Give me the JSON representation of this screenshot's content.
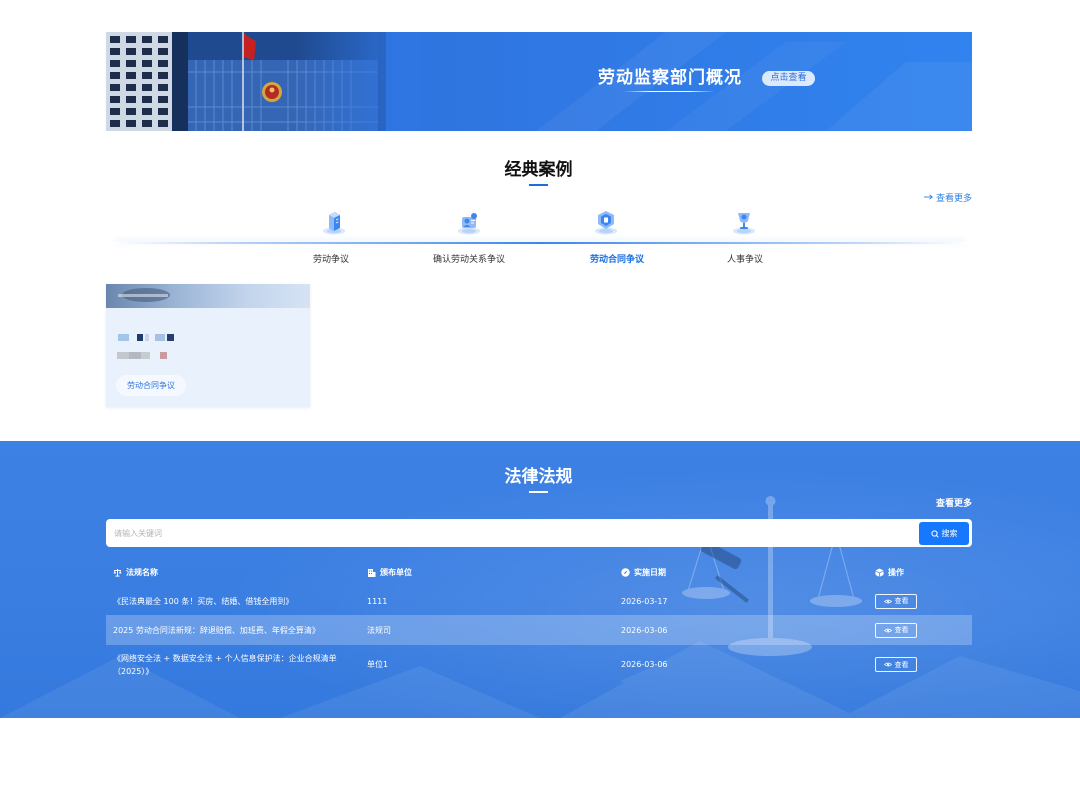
{
  "banner": {
    "title": "劳动监察部门概况",
    "button": "点击查看"
  },
  "cases": {
    "title": "经典案例",
    "more": "查看更多",
    "more_icon": "arrow-right-icon",
    "categories": [
      {
        "label": "劳动争议",
        "icon": "document-stack-icon",
        "active": false
      },
      {
        "label": "确认劳动关系争议",
        "icon": "person-badge-icon",
        "active": false
      },
      {
        "label": "劳动合同争议",
        "icon": "shield-document-icon",
        "active": true
      },
      {
        "label": "人事争议",
        "icon": "person-trophy-icon",
        "active": false
      }
    ],
    "cards": [
      {
        "tag": "劳动合同争议"
      }
    ]
  },
  "laws": {
    "title": "法律法规",
    "more": "查看更多",
    "search": {
      "placeholder": "请输入关键词",
      "button": "搜索",
      "icon": "search-icon"
    },
    "columns": [
      {
        "label": "法规名称",
        "icon": "scales-icon"
      },
      {
        "label": "颁布单位",
        "icon": "building-icon"
      },
      {
        "label": "实施日期",
        "icon": "compass-icon"
      },
      {
        "label": "操作",
        "icon": "cube-icon"
      }
    ],
    "rows": [
      {
        "name": "《民法典最全 100 条！买房、结婚、借钱全用到》",
        "unit": "1111",
        "date": "2026-03-17",
        "action": "查看",
        "action_icon": "eye-icon",
        "highlighted": false
      },
      {
        "name": "2025 劳动合同法新规：辞退赔偿、加班费、年假全算清》",
        "unit": "法规司",
        "date": "2026-03-06",
        "action": "查看",
        "action_icon": "eye-icon",
        "highlighted": true
      },
      {
        "name": "《网络安全法 + 数据安全法 + 个人信息保护法：企业合规清单（2025）》",
        "unit": "单位1",
        "date": "2026-03-06",
        "action": "查看",
        "action_icon": "eye-icon",
        "highlighted": false
      }
    ]
  },
  "colors": {
    "accent": "#1a6fe0",
    "section_bg": "#3a7ee2",
    "search_button": "#1677ff",
    "card_bg": "#e9f1fd",
    "flag_red": "#c62020"
  }
}
